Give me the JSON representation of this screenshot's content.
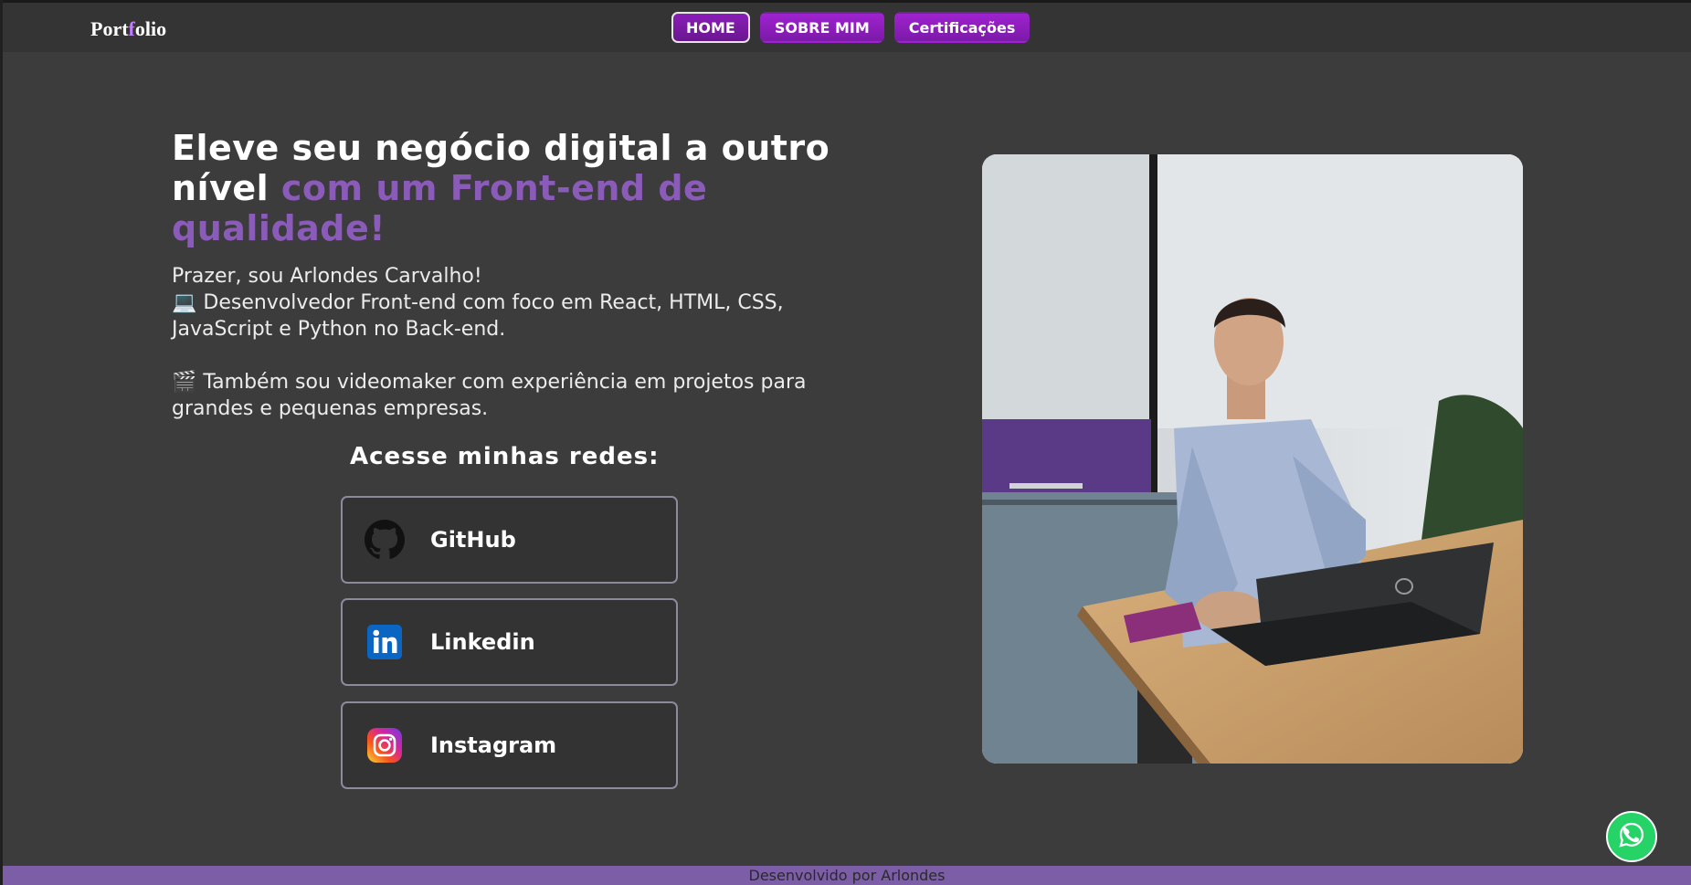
{
  "header": {
    "logo_part1": "Port",
    "logo_accent": "f",
    "logo_part2": "olio",
    "nav": [
      "HOME",
      "SOBRE MIM",
      "Certificações"
    ]
  },
  "hero": {
    "title_white": "Eleve seu negócio digital a outro nível",
    "title_highlight": "com um Front-end de qualidade!",
    "greeting": "Prazer, sou Arlondes Carvalho!",
    "dev_line": "💻 Desenvolvedor Front-end com foco em React, HTML, CSS, JavaScript e Python no Back-end.",
    "video_line": "🎬 Também sou videomaker com experiência em projetos para grandes e pequenas empresas."
  },
  "socials": {
    "title": "Acesse minhas redes:",
    "items": [
      {
        "label": "GitHub",
        "icon": "github-icon"
      },
      {
        "label": "Linkedin",
        "icon": "linkedin-icon"
      },
      {
        "label": "Instagram",
        "icon": "instagram-icon"
      }
    ]
  },
  "photo": {
    "icon": "profile-photo"
  },
  "whatsapp": {
    "icon": "whatsapp-icon"
  },
  "footer": {
    "text": "Desenvolvido por Arlondes"
  },
  "colors": {
    "background": "#3c3c3c",
    "header": "#343434",
    "nav_button": "#9f22cf",
    "highlight": "#8a5bb8",
    "footer": "#7b5ea6",
    "whatsapp": "#25d366"
  }
}
